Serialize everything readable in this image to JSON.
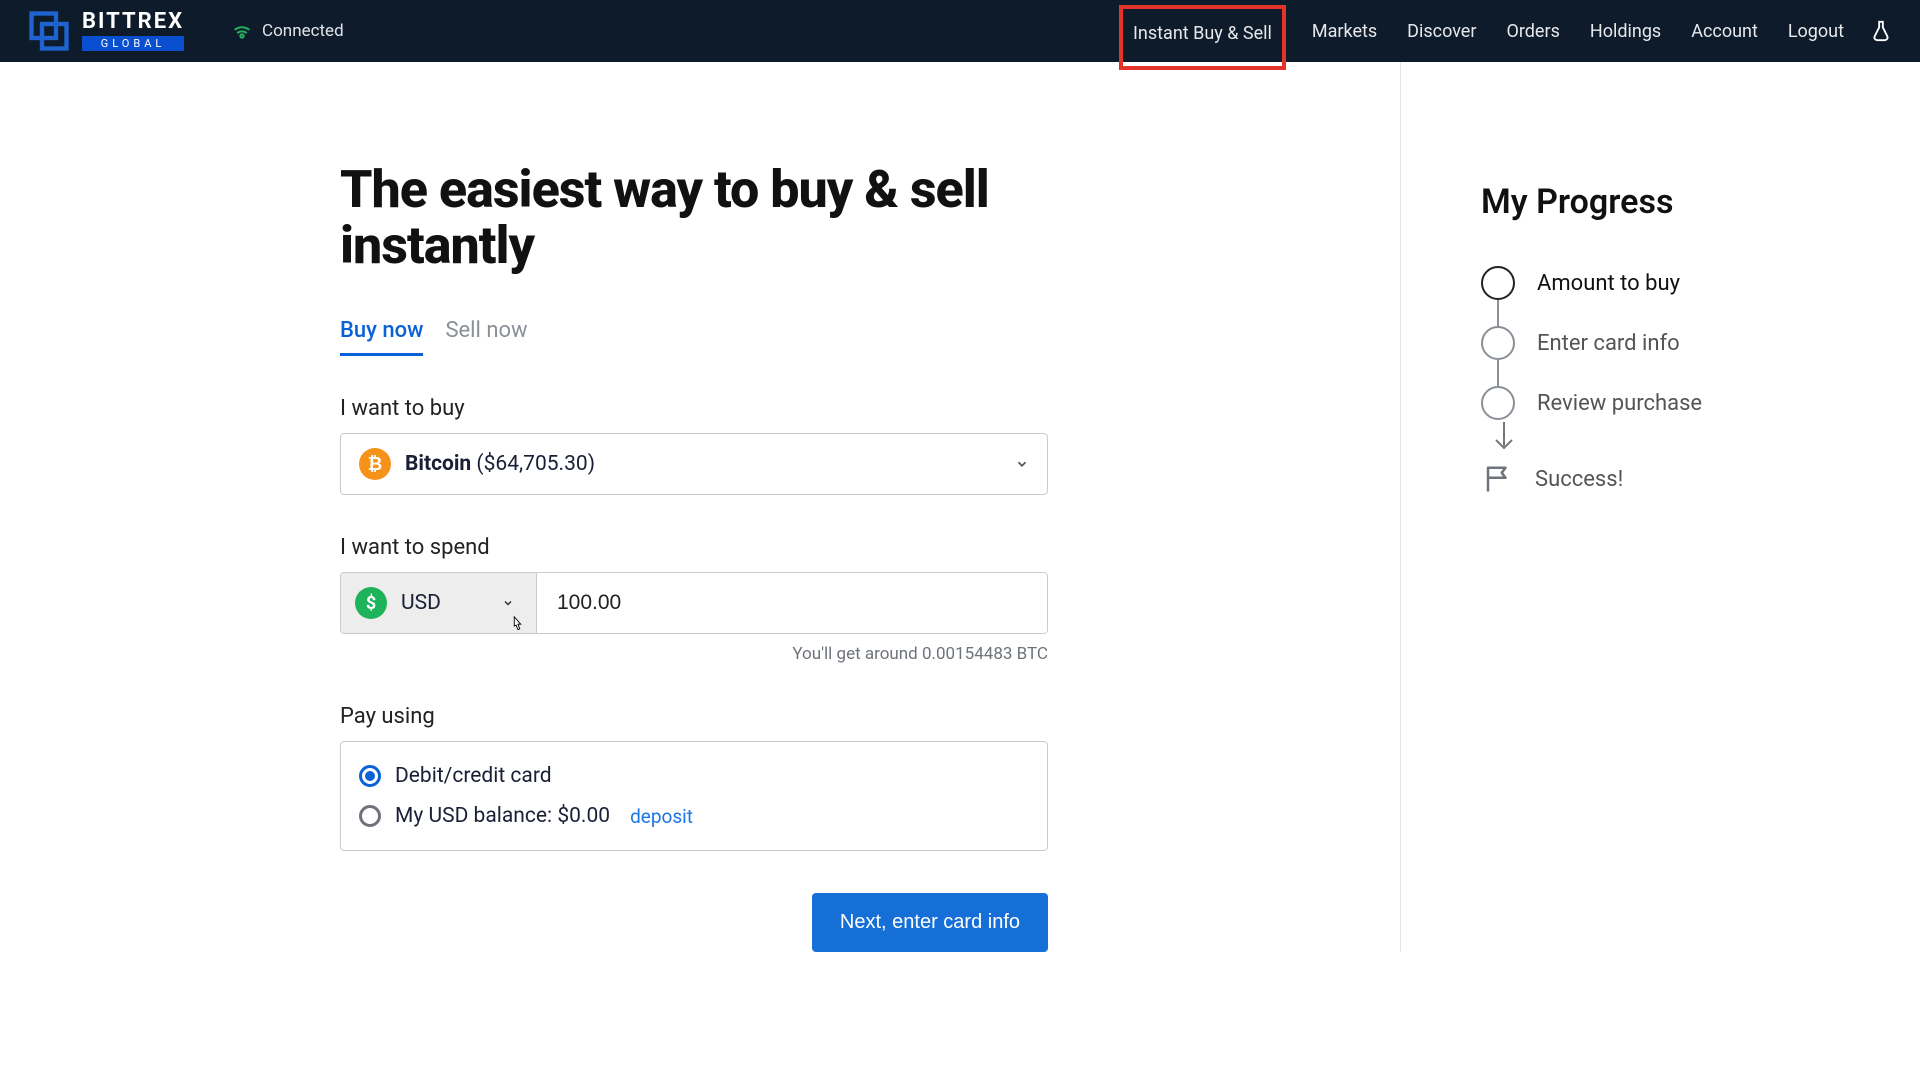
{
  "brand": {
    "name": "BITTREX",
    "sub": "GLOBAL"
  },
  "connection": {
    "label": "Connected"
  },
  "nav": {
    "instant": "Instant Buy & Sell",
    "markets": "Markets",
    "discover": "Discover",
    "orders": "Orders",
    "holdings": "Holdings",
    "account": "Account",
    "logout": "Logout"
  },
  "main": {
    "title": "The easiest way to buy & sell instantly",
    "tab_buy": "Buy now",
    "tab_sell": "Sell now",
    "label_want_buy": "I want to buy",
    "asset_symbol": "₿",
    "asset_name": "Bitcoin",
    "asset_price": "($64,705.30)",
    "label_want_spend": "I want to spend",
    "currency_symbol_glyph": "$",
    "currency_code": "USD",
    "amount_value": "100.00",
    "estimate_text": "You'll get around 0.00154483 BTC",
    "label_pay_using": "Pay using",
    "pay_card": "Debit/credit card",
    "pay_balance_prefix": "My USD balance: $",
    "pay_balance_amount": "0.00",
    "deposit_link": "deposit",
    "next_button": "Next, enter card info"
  },
  "progress": {
    "title": "My Progress",
    "step1": "Amount to buy",
    "step2": "Enter card info",
    "step3": "Review purchase",
    "step4": "Success!"
  }
}
